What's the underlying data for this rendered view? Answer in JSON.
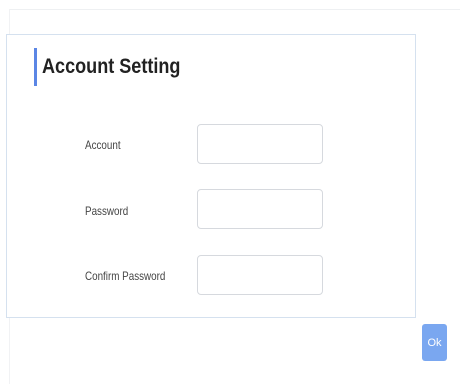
{
  "account_setting": {
    "title": "Account Setting",
    "fields": [
      {
        "label": "Account",
        "value": "",
        "placeholder": ""
      },
      {
        "label": "Password",
        "value": "",
        "placeholder": ""
      },
      {
        "label": "Confirm Password",
        "value": "",
        "placeholder": ""
      }
    ]
  },
  "actions": {
    "ok_label": "Ok"
  },
  "colors": {
    "accent": "#5b86e5",
    "ok_button": "#7aa7f0",
    "panel_border": "#d5e1ef"
  }
}
